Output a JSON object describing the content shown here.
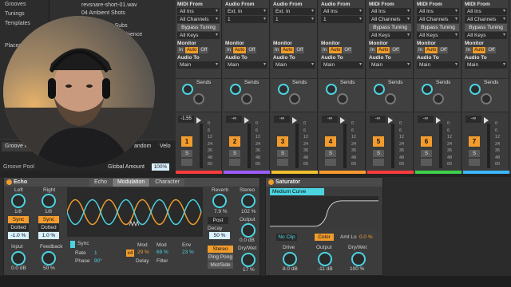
{
  "browser": {
    "left_items": [
      "Grooves",
      "Tunings",
      "Templates",
      "",
      "",
      "Places"
    ],
    "folder_rows": [
      "revsnare-short-01.wav",
      "04 Ambient Shots",
      "& Subs",
      "Ambience"
    ],
    "groove_pool_tab": "Groove Pool",
    "groove_pool_label": "Groove Pool",
    "col_random": "andom",
    "col_velocity": "Velo",
    "global_amount_label": "Global Amount",
    "global_amount_value": "100%"
  },
  "mixer": {
    "strips": [
      {
        "midi_from": "MIDI From",
        "in1": "All Ins",
        "in2": "All Channels",
        "bypass": "Bypass Tuning",
        "keys": "All Keys",
        "monitor": "Monitor",
        "mon": [
          "In",
          "Auto",
          "Off"
        ],
        "audio_to": "Audio To",
        "out": "Main",
        "sends": "Sends",
        "vol": "-1.55",
        "num": "1",
        "color": "#ff3b3b"
      },
      {
        "midi_from": "Audio From",
        "in1": "Ext. In",
        "in2": "1",
        "bypass": "",
        "keys": "",
        "monitor": "Monitor",
        "mon": [
          "In",
          "Auto",
          "Off"
        ],
        "audio_to": "Audio To",
        "out": "Main",
        "sends": "Sends",
        "vol": "-∞",
        "num": "2",
        "color": "#9d5cff"
      },
      {
        "midi_from": "Audio From",
        "in1": "Ext. In",
        "in2": "1",
        "bypass": "",
        "keys": "",
        "monitor": "Monitor",
        "mon": [
          "In",
          "Auto",
          "Off"
        ],
        "audio_to": "Audio To",
        "out": "Main",
        "sends": "Sends",
        "vol": "-∞",
        "num": "3",
        "color": "#f2c12e"
      },
      {
        "midi_from": "Audio From",
        "in1": "All Ins",
        "in2": "1",
        "bypass": "",
        "keys": "",
        "monitor": "Monitor",
        "mon": [
          "In",
          "Auto",
          "Off"
        ],
        "audio_to": "Audio To",
        "out": "Main",
        "sends": "Sends",
        "vol": "-∞",
        "num": "4",
        "color": "#ff9a2e"
      },
      {
        "midi_from": "MIDI From",
        "in1": "All Ins",
        "in2": "All Channels",
        "bypass": "Bypass Tuning",
        "keys": "All Keys",
        "monitor": "Monitor",
        "mon": [
          "In",
          "Auto",
          "Off"
        ],
        "audio_to": "Audio To",
        "out": "Main",
        "sends": "Sends",
        "vol": "-∞",
        "num": "5",
        "color": "#ff3b3b"
      },
      {
        "midi_from": "MIDI From",
        "in1": "All Ins",
        "in2": "All Channels",
        "bypass": "Bypass Tuning",
        "keys": "All Keys",
        "monitor": "Monitor",
        "mon": [
          "In",
          "Auto",
          "Off"
        ],
        "audio_to": "Audio To",
        "out": "Main",
        "sends": "Sends",
        "vol": "-∞",
        "num": "6",
        "color": "#3fd14b"
      },
      {
        "midi_from": "MIDI From",
        "in1": "All Ins",
        "in2": "All Channels",
        "bypass": "Bypass Tuning",
        "keys": "All Keys",
        "monitor": "Monitor",
        "mon": [
          "In",
          "Auto",
          "Off"
        ],
        "audio_to": "Audio To",
        "out": "Main",
        "sends": "Sends",
        "vol": "-∞",
        "num": "7",
        "color": "#3bb7ff"
      }
    ],
    "scale": [
      "0",
      "6",
      "12",
      "24",
      "36",
      "48",
      "60"
    ],
    "solo": "S"
  },
  "echo": {
    "title": "Echo",
    "tabs": [
      "Echo",
      "Modulation",
      "Character"
    ],
    "left_label": "Left",
    "left_val": "1/8",
    "left_sync": "Sync",
    "left_mode": "Dotted",
    "left_off": "-1.0 %",
    "right_label": "Right",
    "right_val": "1/8",
    "right_sync": "Sync",
    "right_mode": "Dotted",
    "right_off": "1.0 %",
    "input_label": "Input",
    "input_val": "0.0 dB",
    "feedback_label": "Feedback",
    "feedback_val": "50 %",
    "sync_label": "Sync",
    "rate_label": "Rate",
    "rate_val": "1",
    "phase_label": "Phase",
    "phase_val": "90°",
    "mod_label1": "Mod",
    "mod_val1": "29 %",
    "delay_label": "Delay",
    "mod_label2": "Mod",
    "mod_val2": "69 %",
    "filter_label": "Filter",
    "env_label": "Env",
    "env_val": "23 %",
    "x4": "x4",
    "reverb_label": "Reverb",
    "reverb_val": "7.9 %",
    "post": "Post",
    "decay_label": "Decay",
    "decay_val": "50 %",
    "stereo_label": "Stereo",
    "stereo_val": "102 %",
    "output_label": "Output",
    "output_val": "0.0 dB",
    "stereo_btn": "Stereo",
    "pingpong_btn": "Ping Pong",
    "midside_btn": "Mid/Side",
    "drywet_label": "Dry/Wet",
    "drywet_val": "17 %"
  },
  "saturator": {
    "title": "Saturator",
    "curve": "Medium Curve",
    "noclip": "No Clip",
    "color": "Color",
    "amtlo_label": "Amt Lo",
    "amtlo_val": "0.0 %",
    "drive_label": "Drive",
    "drive_val": "8.0 dB",
    "output_label": "Output",
    "output_val": "-11 dB",
    "drywet_label": "Dry/Wet",
    "drywet_val": "100 %"
  },
  "colors": {
    "accent": "#f29c2d",
    "cyan": "#4bd4e0",
    "panel": "#3c3c3c"
  }
}
